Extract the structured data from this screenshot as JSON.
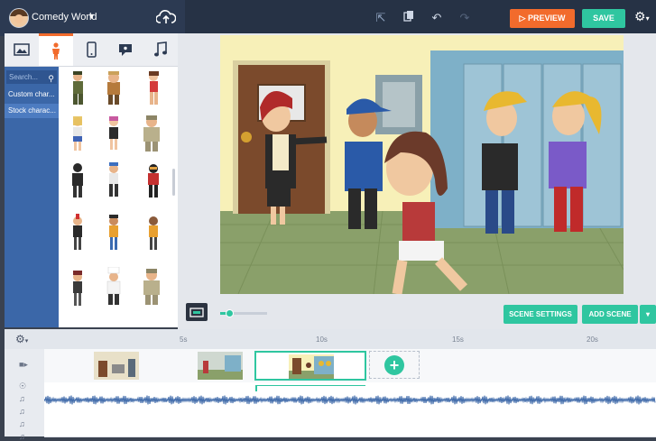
{
  "project": {
    "title": "Comedy World"
  },
  "toolbar": {
    "preview_label": "PREVIEW",
    "save_label": "SAVE"
  },
  "library": {
    "search_placeholder": "Search...",
    "categories": [
      "Custom char...",
      "Stock charac..."
    ],
    "tabs": [
      "image-icon",
      "character-icon",
      "phone-icon",
      "speech-icon",
      "music-icon"
    ]
  },
  "stage": {
    "buttons": {
      "scene_settings": "SCENE SETTINGS",
      "add_scene": "ADD SCENE"
    },
    "zoom": 0.2
  },
  "timeline": {
    "ticks": [
      "5s",
      "10s",
      "15s",
      "20s"
    ]
  },
  "colors": {
    "accent_orange": "#f26b2c",
    "accent_green": "#2fc6a0",
    "nav_dark": "#263245",
    "category_blue": "#3b67a8"
  }
}
